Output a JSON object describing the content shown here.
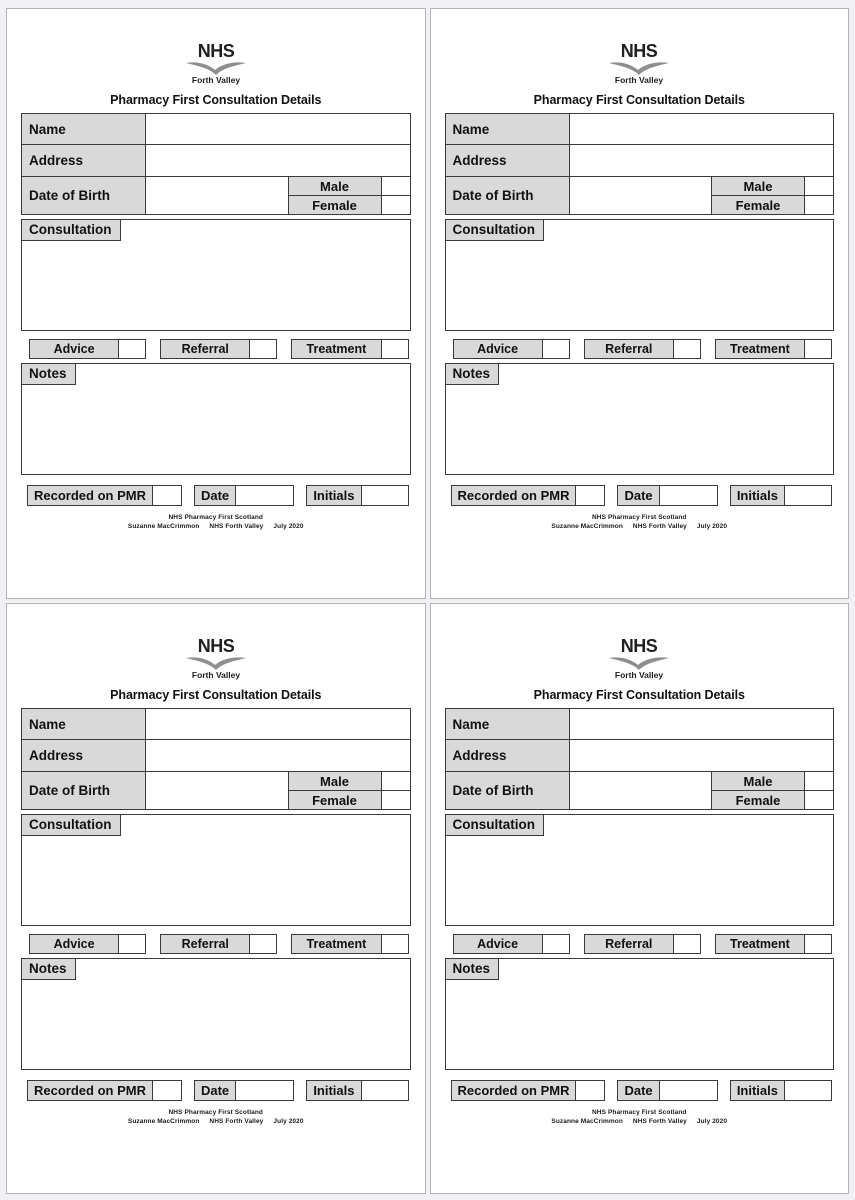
{
  "document": {
    "title": "Pharmacy First Consultation Details",
    "panel_count": 4,
    "layout": "2x2 grid of identical printable forms"
  },
  "logo": {
    "mark": "NHS",
    "board": "Forth Valley",
    "color": "#1f1f1f"
  },
  "form": {
    "title": "Pharmacy First Consultation Details",
    "fields": {
      "name_label": "Name",
      "address_label": "Address",
      "dob_label": "Date of Birth",
      "male_label": "Male",
      "female_label": "Female",
      "consultation_label": "Consultation",
      "notes_label": "Notes"
    },
    "outcomes": [
      {
        "label": "Advice"
      },
      {
        "label": "Referral"
      },
      {
        "label": "Treatment"
      }
    ],
    "record": {
      "pmr_label": "Recorded on PMR",
      "date_label": "Date",
      "initials_label": "Initials"
    },
    "values": {
      "name": "",
      "address": "",
      "dob": "",
      "male_tick": "",
      "female_tick": "",
      "consultation": "",
      "notes": "",
      "advice_tick": "",
      "referral_tick": "",
      "treatment_tick": "",
      "pmr_tick": "",
      "date": "",
      "initials": ""
    }
  },
  "footer": {
    "line1": "NHS Pharmacy First Scotland",
    "author": "Suzanne MacCrimmon",
    "board": "NHS Forth Valley",
    "date": "July 2020"
  },
  "colors": {
    "page_background": "#f1f1f3",
    "panel_background": "#ffffff",
    "label_fill": "#d9d9d9",
    "rule": "#3a3a3a",
    "panel_border": "#b4b4b8"
  }
}
